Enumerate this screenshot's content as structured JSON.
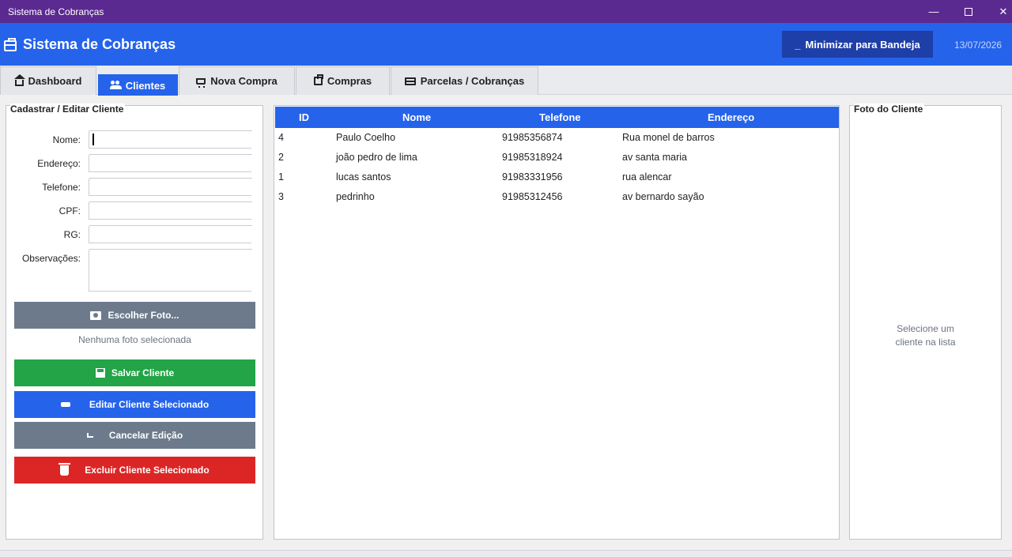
{
  "window": {
    "title": "Sistema de Cobranças"
  },
  "header": {
    "title": "Sistema de Cobranças",
    "tray_button": "Minimizar para Bandeja",
    "tray_icon": "_",
    "date": "13/07/2026"
  },
  "tabs": [
    {
      "label": "Dashboard",
      "icon": "house-icon",
      "active": false
    },
    {
      "label": "Clientes",
      "icon": "users-icon",
      "active": true
    },
    {
      "label": "Nova Compra",
      "icon": "cart-icon",
      "active": false
    },
    {
      "label": "Compras",
      "icon": "bag-icon",
      "active": false
    },
    {
      "label": "Parcelas / Cobranças",
      "icon": "card-icon",
      "active": false
    }
  ],
  "form": {
    "title": "Cadastrar / Editar Cliente",
    "fields": [
      {
        "label": "Nome:",
        "value": ""
      },
      {
        "label": "Endereço:",
        "value": ""
      },
      {
        "label": "Telefone:",
        "value": ""
      },
      {
        "label": "CPF:",
        "value": ""
      },
      {
        "label": "RG:",
        "value": ""
      },
      {
        "label": "Observações:",
        "value": ""
      }
    ],
    "choose_photo": "Escolher Foto...",
    "no_photo": "Nenhuma foto selecionada",
    "save": "Salvar Cliente",
    "edit": "Editar Cliente Selecionado",
    "cancel": "Cancelar Edição",
    "delete": "Excluir Cliente Selecionado"
  },
  "table": {
    "columns": [
      "ID",
      "Nome",
      "Telefone",
      "Endereço"
    ],
    "rows": [
      [
        "4",
        "Paulo Coelho",
        "91985356874",
        "Rua monel de barros"
      ],
      [
        "2",
        "joão pedro de lima",
        "91985318924",
        "av santa maria"
      ],
      [
        "1",
        "lucas santos",
        "91983331956",
        "rua alencar"
      ],
      [
        "3",
        "pedrinho",
        "91985312456",
        "av bernardo sayão"
      ]
    ]
  },
  "photo": {
    "title": "Foto do Cliente",
    "hint_line1": "Selecione um",
    "hint_line2": "cliente na lista"
  },
  "colors": {
    "titlebar": "#5b2a91",
    "primary": "#2563eb",
    "success": "#22a447",
    "danger": "#dc2626",
    "neutral": "#6c7a8c"
  }
}
